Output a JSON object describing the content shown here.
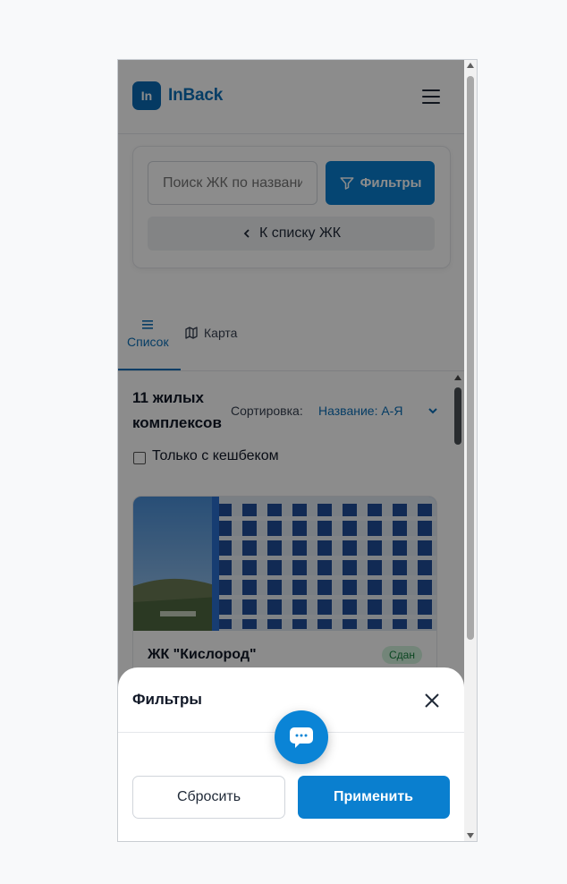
{
  "header": {
    "logo_text": "In",
    "brand": "InBack"
  },
  "search": {
    "placeholder": "Поиск ЖК по названию",
    "filters_label": "Фильтры",
    "back_label": "К списку ЖК"
  },
  "tabs": [
    {
      "label": "Список",
      "icon": "list-icon"
    },
    {
      "label": "Карта",
      "icon": "map-icon"
    }
  ],
  "results": {
    "count_text": "11 жилых комплексов",
    "sort_label": "Сортировка:",
    "sort_value": "Название: А-Я",
    "cashback_label": "Только с кешбеком"
  },
  "card": {
    "title": "ЖК \"Кислород\"",
    "badge": "Сдан"
  },
  "sheet": {
    "title": "Фильтры",
    "reset_label": "Сбросить",
    "apply_label": "Применить"
  },
  "colors": {
    "accent": "#0a7fcf",
    "brand": "#0b6fb8",
    "badge_bg": "#d1f2dc",
    "badge_fg": "#15803d"
  }
}
